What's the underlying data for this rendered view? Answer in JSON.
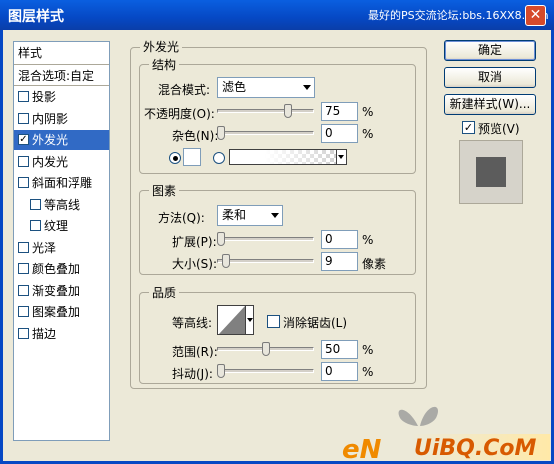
{
  "window": {
    "title": "图层样式",
    "watermark": "最好的PS交流论坛:bbs.16XX8.com",
    "close": "✕"
  },
  "left_panel": {
    "header": "样式",
    "blend_label": "混合选项:自定",
    "items": [
      {
        "label": "投影",
        "checked": false,
        "active": false
      },
      {
        "label": "内阴影",
        "checked": false,
        "active": false
      },
      {
        "label": "外发光",
        "checked": true,
        "active": true
      },
      {
        "label": "内发光",
        "checked": false,
        "active": false
      },
      {
        "label": "斜面和浮雕",
        "checked": false,
        "active": false
      },
      {
        "label": "等高线",
        "checked": false,
        "active": false
      },
      {
        "label": "纹理",
        "checked": false,
        "active": false
      },
      {
        "label": "光泽",
        "checked": false,
        "active": false
      },
      {
        "label": "颜色叠加",
        "checked": false,
        "active": false
      },
      {
        "label": "渐变叠加",
        "checked": false,
        "active": false
      },
      {
        "label": "图案叠加",
        "checked": false,
        "active": false
      },
      {
        "label": "描边",
        "checked": false,
        "active": false
      }
    ]
  },
  "outer_glow": {
    "title": "外发光",
    "structure": {
      "title": "结构",
      "blend_mode_label": "混合模式:",
      "blend_mode_value": "滤色",
      "opacity_label": "不透明度(O):",
      "opacity_value": "75",
      "opacity_fraction": 0.75,
      "noise_label": "杂色(N):",
      "noise_value": "0",
      "noise_fraction": 0,
      "unit": "%"
    },
    "elements": {
      "title": "图素",
      "technique_label": "方法(Q):",
      "technique_value": "柔和",
      "spread_label": "扩展(P):",
      "spread_value": "0",
      "spread_fraction": 0,
      "size_label": "大小(S):",
      "size_value": "9",
      "size_fraction": 0.06,
      "size_unit": "像素",
      "unit": "%"
    },
    "quality": {
      "title": "品质",
      "contour_label": "等高线:",
      "antialias_label": "消除锯齿(L)",
      "range_label": "范围(R):",
      "range_value": "50",
      "range_fraction": 0.5,
      "jitter_label": "抖动(J):",
      "jitter_value": "0",
      "jitter_fraction": 0,
      "unit": "%"
    }
  },
  "buttons": {
    "ok": "确定",
    "cancel": "取消",
    "new_style": "新建样式(W)...",
    "preview": "预览(V)"
  },
  "colors": {
    "active_item": "#316ac5",
    "preview_swatch": "#5c5c5c",
    "title_bar": "#0648c4"
  }
}
